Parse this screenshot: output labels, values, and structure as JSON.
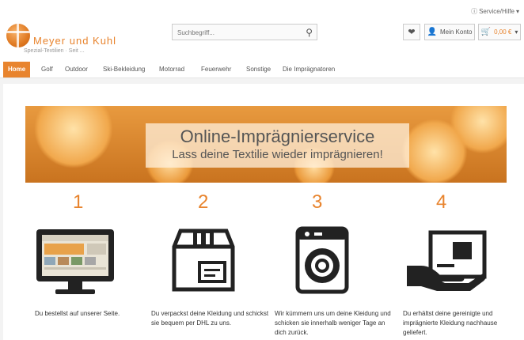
{
  "header": {
    "service_label": "Service/Hilfe",
    "logo_name": "Meyer und Kuhl",
    "logo_sub": "Spezial-Textilien · Seit ...",
    "search_placeholder": "Suchbegriff...",
    "account_label": "Mein Konto",
    "cart_total": "0,00 €"
  },
  "nav": [
    {
      "label": "Home",
      "active": true
    },
    {
      "label": "Golf"
    },
    {
      "label": "Outdoor"
    },
    {
      "label": "Ski-Bekleidung"
    },
    {
      "label": "Motorrad"
    },
    {
      "label": "Feuerwehr"
    },
    {
      "label": "Sonstige"
    },
    {
      "label": "Die Imprägnatoren"
    }
  ],
  "banner": {
    "title": "Online-Imprägnierservice",
    "subtitle": "Lass deine Textilie wieder imprägnieren!"
  },
  "steps": [
    {
      "number": "1",
      "icon": "monitor-icon",
      "text": "Du bestellst auf unserer Seite."
    },
    {
      "number": "2",
      "icon": "package-icon",
      "text": "Du verpackst deine Kleidung und schickst sie bequem per DHL zu uns."
    },
    {
      "number": "3",
      "icon": "washing-machine-icon",
      "text": "Wir kümmern uns um deine Kleidung und schicken sie innerhalb weniger Tage an dich zurück."
    },
    {
      "number": "4",
      "icon": "hand-package-icon",
      "text": "Du erhältst deine gereinigte und imprägnierte Kleidung nachhause geliefert."
    }
  ],
  "colors": {
    "accent": "#e8842e",
    "icon_dark": "#222222"
  }
}
